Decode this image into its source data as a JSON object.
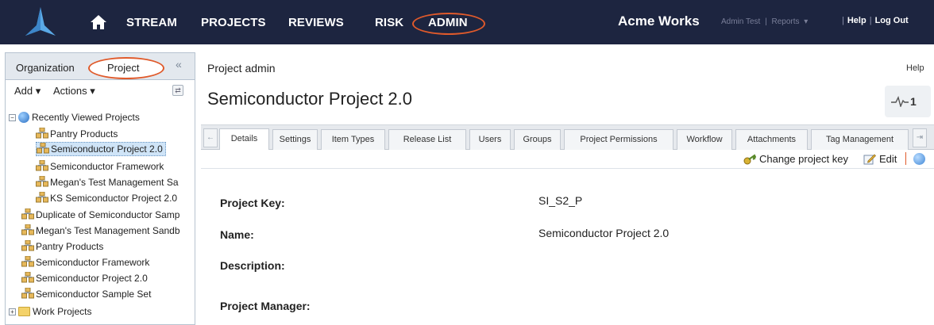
{
  "colors": {
    "topbar_bg": "#1d2540",
    "annotation_ring": "#e05a2b",
    "selection_bg": "#cfe4f7",
    "panel_border": "#b7c3d0"
  },
  "topnav": {
    "logo_icon": "brand-logo-icon",
    "home_icon": "home-icon",
    "items": [
      "STREAM",
      "PROJECTS",
      "REVIEWS",
      "RISK",
      "ADMIN"
    ],
    "org_name": "Acme Works",
    "user_name": "Admin Test",
    "reports": "Reports",
    "reports_arrow": "▾",
    "sep": "|",
    "help": "Help",
    "logout": "Log Out"
  },
  "leftpanel": {
    "tabs": [
      "Organization",
      "Project"
    ],
    "collapse_icon": "«",
    "add_label": "Add ▾",
    "actions_label": "Actions ▾",
    "refresh_icon": "⇄",
    "tree": {
      "recent_label": "Recently Viewed Projects",
      "recent": [
        "Pantry Products",
        "Semiconductor Project 2.0",
        "Semiconductor Framework",
        "Megan's Test Management Sa",
        "KS Semiconductor Project 2.0"
      ],
      "projects": [
        "Duplicate of Semiconductor Samp",
        "Megan's Test Management Sandb",
        "Pantry Products",
        "Semiconductor Framework",
        "Semiconductor Project 2.0",
        "Semiconductor Sample Set"
      ],
      "folder_label": "Work Projects",
      "expander_minus": "−",
      "expander_plus": "+"
    }
  },
  "main": {
    "page_title": "Project admin",
    "help": "Help",
    "project_name": "Semiconductor Project 2.0",
    "activity_count": "1",
    "tab_scroll_left": "←",
    "tab_scroll_right": "⇥",
    "tabs": [
      "Details",
      "Settings",
      "Item Types",
      "Release List",
      "Users",
      "Groups",
      "Project Permissions",
      "Workflow",
      "Attachments",
      "Tag Management"
    ],
    "actions": {
      "change_key": "Change project key",
      "edit": "Edit"
    },
    "fields": [
      {
        "label": "Project Key:",
        "value": "SI_S2_P"
      },
      {
        "label": "Name:",
        "value": "Semiconductor Project 2.0"
      },
      {
        "label": "Description:",
        "value": ""
      },
      {
        "label": "Project Manager:",
        "value": ""
      }
    ]
  }
}
